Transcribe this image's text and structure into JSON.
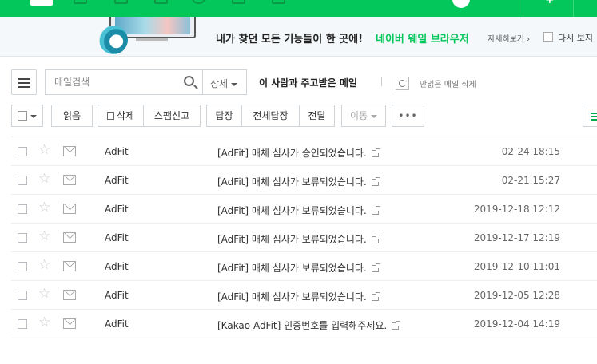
{
  "banner": {
    "text": "내가 찾던 모든 기능들이 한 곳에!",
    "accent": "네이버 웨일 브라우저",
    "more": "자세히보기 ›",
    "dont_show": "다시 보지"
  },
  "search": {
    "placeholder": "메일검색",
    "detail_label": "상세",
    "contact_link": "이 사람과 주고받은 메일",
    "unread_delete": "안읽은 메일 삭제"
  },
  "toolbar": {
    "read": "읽음",
    "delete": "삭제",
    "spam": "스팸신고",
    "reply": "답장",
    "reply_all": "전체답장",
    "forward": "전달",
    "move": "이동",
    "more": "•••"
  },
  "colors": {
    "brand": "#03c75a"
  },
  "mails": [
    {
      "sender": "AdFit",
      "subject": "[AdFit] 매체 심사가 승인되었습니다.",
      "date": "02-24 18:15"
    },
    {
      "sender": "AdFit",
      "subject": "[AdFit] 매체 심사가 보류되었습니다.",
      "date": "02-21 15:27"
    },
    {
      "sender": "AdFit",
      "subject": "[AdFit] 매체 심사가 보류되었습니다.",
      "date": "2019-12-18 12:12"
    },
    {
      "sender": "AdFit",
      "subject": "[AdFit] 매체 심사가 보류되었습니다.",
      "date": "2019-12-17 12:19"
    },
    {
      "sender": "AdFit",
      "subject": "[AdFit] 매체 심사가 보류되었습니다.",
      "date": "2019-12-10 11:01"
    },
    {
      "sender": "AdFit",
      "subject": "[AdFit] 매체 심사가 보류되었습니다.",
      "date": "2019-12-05 12:28"
    },
    {
      "sender": "AdFit",
      "subject": "[Kakao AdFit] 인증번호를 입력해주세요.",
      "date": "2019-12-04 14:19"
    }
  ]
}
